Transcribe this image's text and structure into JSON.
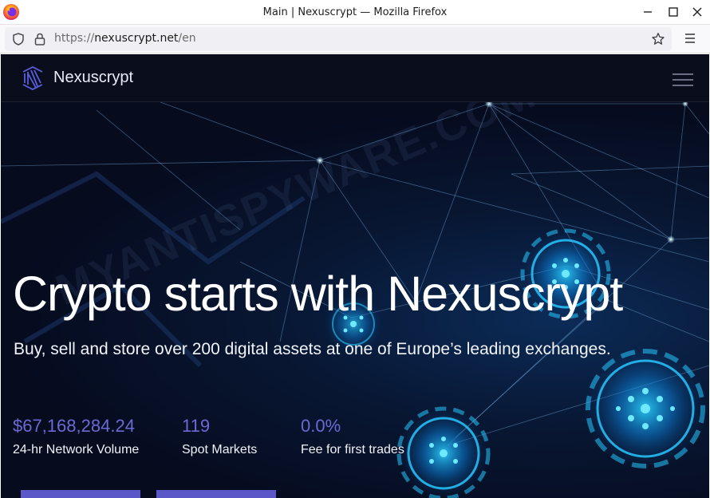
{
  "window": {
    "title": "Main | Nexuscrypt — Mozilla Firefox"
  },
  "browser": {
    "url_scheme": "https://",
    "url_host": "nexuscrypt.net",
    "url_path": "/en"
  },
  "site": {
    "brand_name": "Nexuscrypt"
  },
  "hero": {
    "title": "Crypto starts with Nexuscrypt",
    "subtitle": "Buy, sell and store over 200 digital assets at one of Europe’s leading exchanges.",
    "watermark": "MYANTISPYWARE.COM"
  },
  "stats": [
    {
      "value": "$67,168,284.24",
      "label": "24-hr Network Volume"
    },
    {
      "value": "119",
      "label": "Spot Markets"
    },
    {
      "value": "0.0%",
      "label": "Fee for first trades"
    }
  ],
  "colors": {
    "accent": "#6b6ad4",
    "button": "#5b57c9",
    "header_bg": "#0a0d1c",
    "hero_bg": "#070b1d",
    "glow": "#2fd6ff"
  },
  "icons": {
    "browser_logo": "firefox-logo-icon",
    "tracking": "shield-icon",
    "security": "lock-icon",
    "bookmark": "star-icon",
    "app_menu": "menu-icon",
    "site_menu": "hamburger-icon"
  }
}
